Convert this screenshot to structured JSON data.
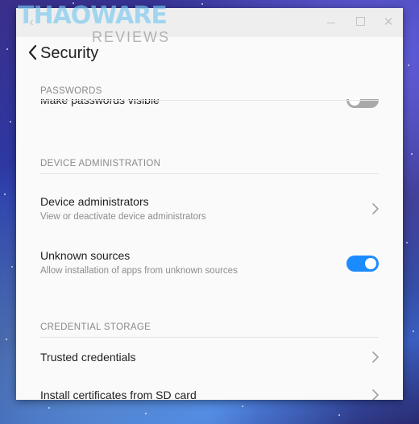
{
  "watermark": {
    "brand": "THAOWARE",
    "sub": "REVIEWS"
  },
  "window": {
    "back_glyph": "‹",
    "close_glyph": "✕"
  },
  "appbar": {
    "title": "Security"
  },
  "sections": {
    "passwords": {
      "header": "PASSWORDS",
      "make_visible": {
        "title": "Make passwords visible",
        "toggle_on": false
      }
    },
    "device_admin": {
      "header": "DEVICE ADMINISTRATION",
      "device_administrators": {
        "title": "Device administrators",
        "subtitle": "View or deactivate device administrators"
      },
      "unknown_sources": {
        "title": "Unknown sources",
        "subtitle": "Allow installation of apps from unknown sources",
        "toggle_on": true
      }
    },
    "credential_storage": {
      "header": "CREDENTIAL STORAGE",
      "trusted_credentials": {
        "title": "Trusted credentials"
      },
      "install_certificates": {
        "title": "Install certificates from SD card"
      }
    }
  },
  "colors": {
    "accent": "#1a8cff",
    "toggle_off": "#a9a9a9",
    "section_header": "#8a8a8a"
  },
  "icons": [
    "back-arrow-icon",
    "minimize-icon",
    "maximize-icon",
    "close-icon",
    "chevron-right-icon"
  ]
}
